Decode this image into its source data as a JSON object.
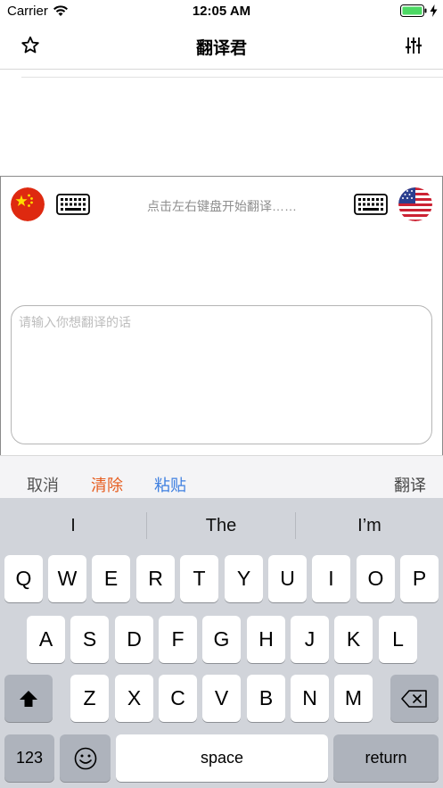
{
  "status_bar": {
    "carrier": "Carrier",
    "time": "12:05 AM"
  },
  "nav": {
    "title": "翻译君",
    "left_icon": "star-icon",
    "right_icon": "sliders-icon"
  },
  "panel": {
    "hint": "点击左右键盘开始翻译……",
    "source_flag": "china-flag",
    "target_flag": "usa-flag",
    "input_placeholder": "请输入你想翻译的话",
    "input_value": ""
  },
  "toolbar": {
    "cancel": "取消",
    "clear": "清除",
    "paste": "粘贴",
    "translate": "翻译"
  },
  "colors": {
    "clear": "#e65d1f",
    "paste": "#3e7fe0",
    "keyboard_bg": "#d1d4da"
  },
  "keyboard": {
    "suggestions": [
      "I",
      "The",
      "I’m"
    ],
    "row1": [
      "Q",
      "W",
      "E",
      "R",
      "T",
      "Y",
      "U",
      "I",
      "O",
      "P"
    ],
    "row2": [
      "A",
      "S",
      "D",
      "F",
      "G",
      "H",
      "J",
      "K",
      "L"
    ],
    "row3": [
      "Z",
      "X",
      "C",
      "V",
      "B",
      "N",
      "M"
    ],
    "numbers_key": "123",
    "space_key": "space",
    "return_key": "return"
  }
}
